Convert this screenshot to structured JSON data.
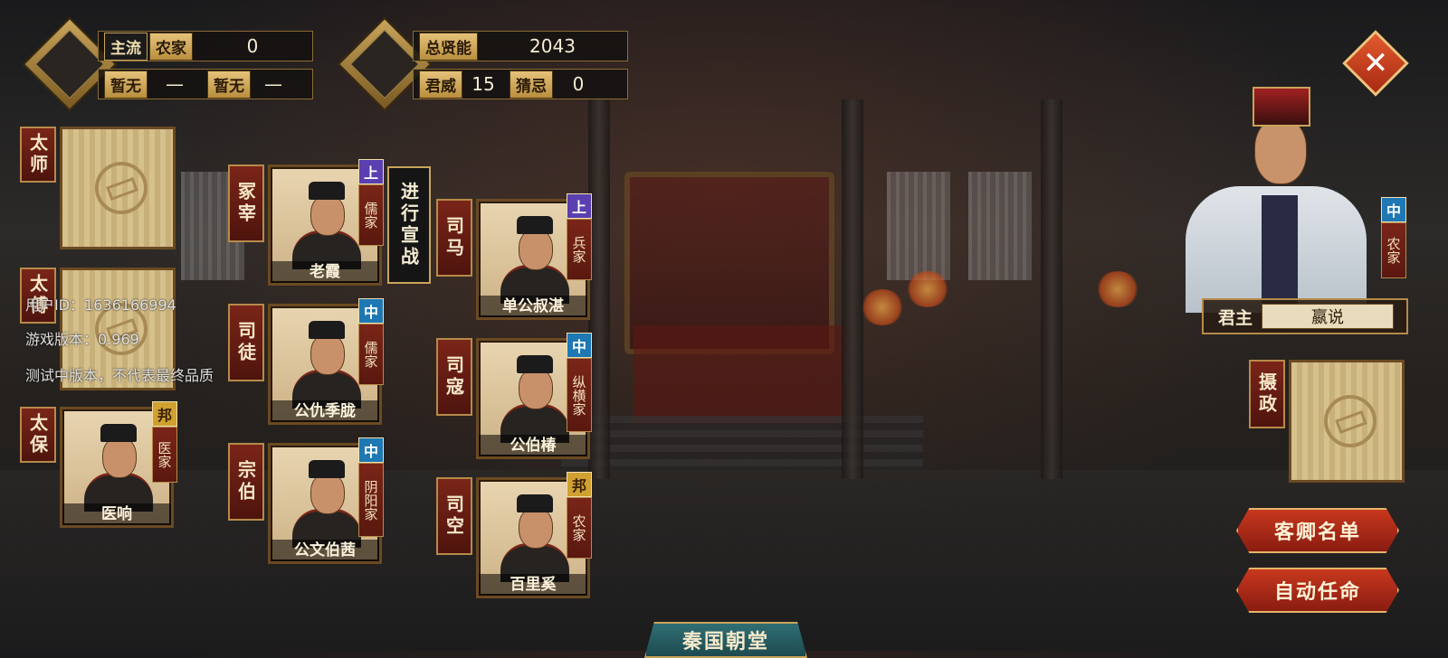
{
  "stats": {
    "mainstream_label": "主流",
    "mainstream_school": "农家",
    "mainstream_value": "0",
    "none1_label": "暂无",
    "none1_value": "—",
    "none2_label": "暂无",
    "none2_value": "—",
    "total_talent_label": "总贤能",
    "total_talent_value": "2043",
    "prestige_label": "君威",
    "prestige_value": "15",
    "suspicion_label": "猜忌",
    "suspicion_value": "0"
  },
  "offices": {
    "taishi": {
      "title": "太师"
    },
    "taifu": {
      "title": "太傅"
    },
    "taibao": {
      "title": "太保",
      "name": "医响",
      "school": "医家",
      "rank": "邦"
    },
    "zhongzai": {
      "title": "冢宰",
      "name": "老霞",
      "school": "儒家",
      "rank": "上"
    },
    "situ": {
      "title": "司徒",
      "name": "公仇季胧",
      "school": "儒家",
      "rank": "中"
    },
    "zongbo": {
      "title": "宗伯",
      "name": "公文伯茜",
      "school": "阴阳家",
      "rank": "中"
    },
    "sima": {
      "title": "司马",
      "name": "单公叔湛",
      "school": "兵家",
      "rank": "上"
    },
    "sikou": {
      "title": "司寇",
      "name": "公伯椿",
      "school": "纵横家",
      "rank": "中"
    },
    "sikong": {
      "title": "司空",
      "name": "百里奚",
      "school": "农家",
      "rank": "邦"
    },
    "regent": {
      "title": "摄政"
    }
  },
  "declare_war": "进行宣战",
  "ruler": {
    "label": "君主",
    "name": "嬴说",
    "school": "农家",
    "rank": "中"
  },
  "buttons": {
    "guest_list": "客卿名单",
    "auto_appoint": "自动任命",
    "close": "✕"
  },
  "debug": {
    "user_id": "用户ID：1636166994",
    "version": "游戏版本：0.969",
    "notice": "测试中版本，不代表最终品质"
  },
  "court_title": "秦国朝堂"
}
